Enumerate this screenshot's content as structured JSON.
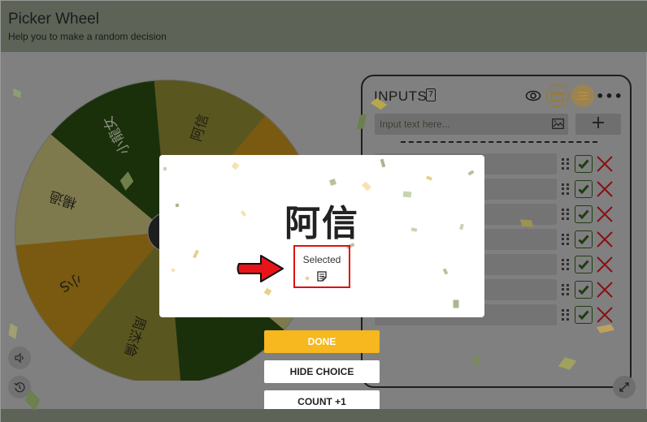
{
  "app": {
    "title": "Picker Wheel",
    "subtitle": "Help you to make a random decision"
  },
  "wheel": {
    "segments": [
      {
        "label": "阿信",
        "color": "#5a5620"
      },
      {
        "label": "",
        "color": "#7a5a10"
      },
      {
        "label": "",
        "color": "#7f7a4e"
      },
      {
        "label": "",
        "color": "#1a300a"
      },
      {
        "label": "周杰倫",
        "color": "#5a5620"
      },
      {
        "label": "小S",
        "color": "#7a5a10"
      },
      {
        "label": "楊過",
        "color": "#7f7a4e"
      },
      {
        "label": "小龍女",
        "color": "#1a300a"
      }
    ]
  },
  "panel": {
    "title": "INPUTS",
    "count": "7",
    "input_placeholder": "Input text here...",
    "add_label": "+",
    "more_label": "•••",
    "entries": [
      {
        "text": "",
        "checked": true
      },
      {
        "text": "",
        "checked": true
      },
      {
        "text": "",
        "checked": true
      },
      {
        "text": "",
        "checked": true
      },
      {
        "text": "",
        "checked": true
      },
      {
        "text": "",
        "checked": true
      },
      {
        "text": "",
        "checked": true
      }
    ]
  },
  "modal": {
    "result": "阿信",
    "selected_label": "Selected"
  },
  "actions": {
    "done": "DONE",
    "hide_choice": "HIDE CHOICE",
    "count": "COUNT +1"
  },
  "colors": {
    "accent": "#f6b71f",
    "check": "#1f3d10",
    "delete": "#8a0f14",
    "highlight": "#e01010"
  }
}
